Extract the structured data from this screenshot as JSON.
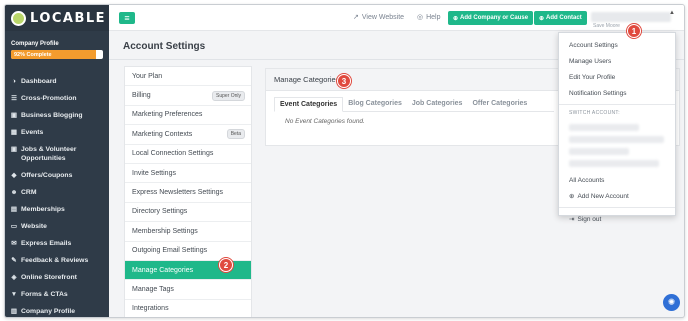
{
  "brand": {
    "logo_text": "LOCABLE"
  },
  "profile": {
    "label": "Company Profile",
    "progress_text": "92% Complete",
    "progress_percent": 92
  },
  "sidebar": {
    "items": [
      {
        "icon": "dashboard-icon",
        "glyph": "◑",
        "label": "Dashboard"
      },
      {
        "icon": "megaphone-icon",
        "glyph": "☰",
        "label": "Cross-Promotion"
      },
      {
        "icon": "briefcase-icon",
        "glyph": "▣",
        "label": "Business Blogging"
      },
      {
        "icon": "calendar-icon",
        "glyph": "▦",
        "label": "Events"
      },
      {
        "icon": "briefcase-icon",
        "glyph": "▣",
        "label": "Jobs & Volunteer Opportunities"
      },
      {
        "icon": "coupon-icon",
        "glyph": "◆",
        "label": "Offers/Coupons"
      },
      {
        "icon": "users-icon",
        "glyph": "☻",
        "label": "CRM"
      },
      {
        "icon": "id-card-icon",
        "glyph": "▤",
        "label": "Memberships"
      },
      {
        "icon": "monitor-icon",
        "glyph": "▭",
        "label": "Website"
      },
      {
        "icon": "envelope-icon",
        "glyph": "✉",
        "label": "Express Emails"
      },
      {
        "icon": "comment-icon",
        "glyph": "✎",
        "label": "Feedback & Reviews"
      },
      {
        "icon": "cart-icon",
        "glyph": "◈",
        "label": "Online Storefront"
      },
      {
        "icon": "filter-icon",
        "glyph": "▼",
        "label": "Forms & CTAs"
      },
      {
        "icon": "building-icon",
        "glyph": "▥",
        "label": "Company Profile"
      }
    ]
  },
  "topbar": {
    "view_website": "View Website",
    "help": "Help",
    "add_company": "Add Company or Cause",
    "add_contact": "Add Contact",
    "user_sub": "Save Moore"
  },
  "page": {
    "title": "Account Settings"
  },
  "settings_menu": [
    {
      "label": "Your Plan",
      "badge": ""
    },
    {
      "label": "Billing",
      "badge": "Super Only"
    },
    {
      "label": "Marketing Preferences",
      "badge": ""
    },
    {
      "label": "Marketing Contexts",
      "badge": "Beta"
    },
    {
      "label": "Local Connection Settings",
      "badge": ""
    },
    {
      "label": "Invite Settings",
      "badge": ""
    },
    {
      "label": "Express Newsletters Settings",
      "badge": ""
    },
    {
      "label": "Directory Settings",
      "badge": ""
    },
    {
      "label": "Membership Settings",
      "badge": ""
    },
    {
      "label": "Outgoing Email Settings",
      "badge": ""
    },
    {
      "label": "Manage Categories",
      "badge": "",
      "active": true
    },
    {
      "label": "Manage Tags",
      "badge": ""
    },
    {
      "label": "Integrations",
      "badge": ""
    }
  ],
  "panel": {
    "title": "Manage Categories",
    "tabs": [
      "Event Categories",
      "Blog Categories",
      "Job Categories",
      "Offer Categories"
    ],
    "active_tab": 0,
    "empty_message": "No Event Categories found."
  },
  "account_dropdown": {
    "items": [
      "Account Settings",
      "Manage Users",
      "Edit Your Profile",
      "Notification Settings"
    ],
    "switch_heading": "SWITCH ACCOUNT:",
    "all_accounts": "All Accounts",
    "add_account": "Add New Account",
    "sign_out": "Sign out"
  },
  "callouts": [
    "1",
    "2",
    "3"
  ],
  "colors": {
    "accent": "#1fb88a",
    "sidebar": "#2f3b48",
    "callout": "#e04a3f",
    "progress": "#f39c2e"
  }
}
